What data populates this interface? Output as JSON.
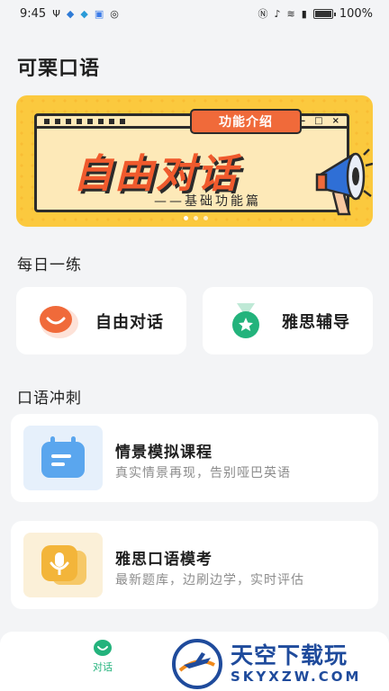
{
  "status_bar": {
    "time": "9:45",
    "battery": "100%"
  },
  "app": {
    "title": "可栗口语"
  },
  "banner": {
    "tag": "功能介绍",
    "headline": "自由对话",
    "subline": "——基础功能篇",
    "slide_count": 3,
    "active_slide": 1
  },
  "daily": {
    "title": "每日一练",
    "items": [
      {
        "label": "自由对话",
        "icon": "smile-icon"
      },
      {
        "label": "雅思辅导",
        "icon": "medal-star-icon"
      }
    ]
  },
  "sprint": {
    "title": "口语冲刺",
    "courses": [
      {
        "title": "情景模拟课程",
        "desc": "真实情景再现，告别哑巴英语",
        "icon": "calendar-icon"
      },
      {
        "title": "雅思口语模考",
        "desc": "最新题库，边刷边学，实时评估",
        "icon": "microphone-chat-icon"
      }
    ]
  },
  "nav": {
    "items": [
      {
        "label": "对话",
        "icon": "smile-icon",
        "active": true
      }
    ]
  },
  "watermark": {
    "main": "天空下载玩",
    "sub": "SKYXZW.COM"
  },
  "colors": {
    "accent_green": "#23b37c",
    "accent_orange": "#f06a3a",
    "banner_yellow": "#fbc93e"
  }
}
